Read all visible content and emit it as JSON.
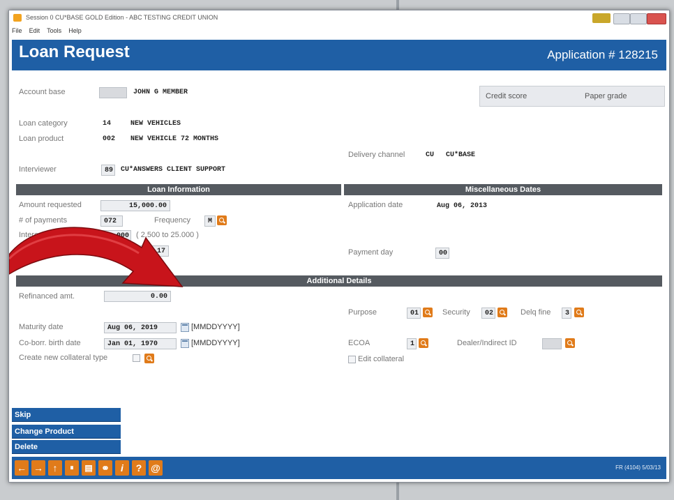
{
  "window": {
    "title": "Session 0 CU*BASE GOLD Edition - ABC TESTING CREDIT UNION"
  },
  "menu": [
    "File",
    "Edit",
    "Tools",
    "Help"
  ],
  "header": {
    "title": "Loan Request",
    "application": "Application # 128215"
  },
  "account": {
    "label": "Account base",
    "name": "JOHN G MEMBER"
  },
  "credit": {
    "score_label": "Credit score",
    "grade_label": "Paper grade"
  },
  "loan_category": {
    "label": "Loan category",
    "code": "14",
    "desc": "NEW VEHICLES"
  },
  "loan_product": {
    "label": "Loan product",
    "code": "002",
    "desc": "NEW VEHICLE 72 MONTHS"
  },
  "delivery": {
    "label": "Delivery channel",
    "code": "CU",
    "desc": "CU*BASE"
  },
  "interviewer": {
    "label": "Interviewer",
    "code": "89",
    "desc": "CU*ANSWERS CLIENT SUPPORT"
  },
  "sections": {
    "loan_info": "Loan Information",
    "misc_dates": "Miscellaneous Dates",
    "additional": "Additional Details"
  },
  "loan_info": {
    "amount_label": "Amount requested",
    "amount": "15,000.00",
    "payments_label": "# of payments",
    "payments": "072",
    "frequency_label": "Frequency",
    "frequency": "M",
    "interest_label": "Interest rate",
    "interest": "14.000",
    "interest_range": "( 2.500 to 25.000 )",
    "payment_label": "Payment",
    "payment": "309.17"
  },
  "misc": {
    "app_date_label": "Application date",
    "app_date": "Aug 06, 2013",
    "payment_day_label": "Payment day",
    "payment_day": "00"
  },
  "details": {
    "refinanced_label": "Refinanced amt.",
    "refinanced": "0.00",
    "maturity_label": "Maturity date",
    "maturity": "Aug 06, 2019",
    "date_format": "[MMDDYYYY]",
    "coborr_label": "Co-borr. birth date",
    "coborr": "Jan 01, 1970",
    "collateral_label": "Create new collateral type",
    "purpose_label": "Purpose",
    "purpose": "01",
    "security_label": "Security",
    "security": "02",
    "delq_label": "Delq fine",
    "delq": "3",
    "ecoa_label": "ECOA",
    "ecoa": "1",
    "dealer_label": "Dealer/Indirect ID",
    "edit_collateral_label": "Edit collateral"
  },
  "sidebar": [
    "Skip",
    "Change Product",
    "Delete"
  ],
  "footer": {
    "icons": [
      "back-arrow-icon",
      "forward-arrow-icon",
      "up-arrow-icon",
      "pause-icon",
      "print-icon",
      "link-icon",
      "info-icon",
      "help-icon",
      "email-icon"
    ],
    "glyphs": [
      "←",
      "→",
      "↑",
      "⏸",
      "▤",
      "⚭",
      "i",
      "?",
      "@"
    ],
    "version": "FR (4104) 5/03/13"
  },
  "colors": {
    "brand_blue": "#1f5fa5",
    "action_orange": "#e07b1a",
    "section_gray": "#555a60",
    "arrow_red": "#c8141b"
  }
}
